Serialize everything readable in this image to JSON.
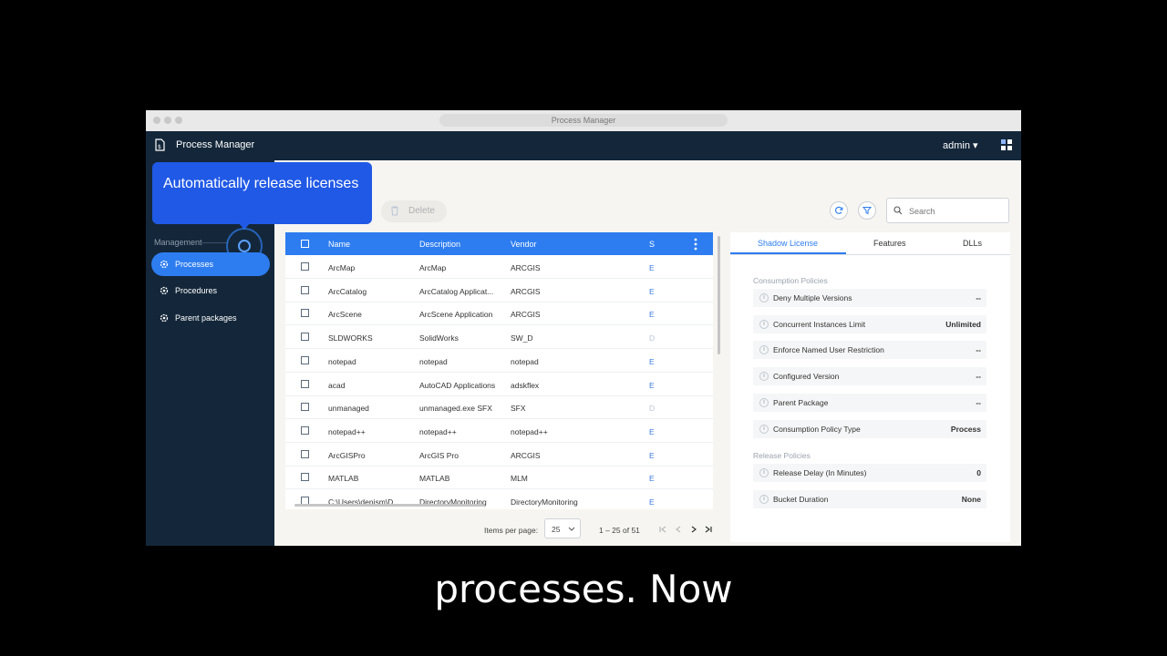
{
  "window": {
    "url_title": "Process Manager"
  },
  "appbar": {
    "title": "Process Manager",
    "user": "admin ▾"
  },
  "tooltip": {
    "text": "Automatically release licenses"
  },
  "sidebar": {
    "section": "Management",
    "items": [
      {
        "label": "Processes",
        "active": true
      },
      {
        "label": "Procedures",
        "active": false
      },
      {
        "label": "Parent packages",
        "active": false
      }
    ]
  },
  "toolbar": {
    "delete_label": "Delete",
    "search_placeholder": "Search"
  },
  "table": {
    "headers": [
      "Name",
      "Description",
      "Vendor",
      "S"
    ],
    "rows": [
      {
        "name": "ArcMap",
        "description": "ArcMap",
        "vendor": "ARCGIS",
        "s": "E"
      },
      {
        "name": "ArcCatalog",
        "description": "ArcCatalog Applicat...",
        "vendor": "ARCGIS",
        "s": "E"
      },
      {
        "name": "ArcScene",
        "description": "ArcScene Application",
        "vendor": "ARCGIS",
        "s": "E"
      },
      {
        "name": "SLDWORKS",
        "description": "SolidWorks",
        "vendor": "SW_D",
        "s": "D"
      },
      {
        "name": "notepad",
        "description": "notepad",
        "vendor": "notepad",
        "s": "E"
      },
      {
        "name": "acad",
        "description": "AutoCAD Applications",
        "vendor": "adskflex",
        "s": "E"
      },
      {
        "name": "unmanaged",
        "description": "unmanaged.exe SFX",
        "vendor": "SFX",
        "s": "D"
      },
      {
        "name": "notepad++",
        "description": "notepad++",
        "vendor": "notepad++",
        "s": "E"
      },
      {
        "name": "ArcGISPro",
        "description": "ArcGIS Pro",
        "vendor": "ARCGIS",
        "s": "E"
      },
      {
        "name": "MATLAB",
        "description": "MATLAB",
        "vendor": "MLM",
        "s": "E"
      },
      {
        "name": "C:\\Users\\denism\\D...",
        "description": "DirectoryMonitoring",
        "vendor": "DirectoryMonitoring",
        "s": "E"
      }
    ]
  },
  "pager": {
    "items_per_page_label": "Items per page:",
    "page_size": "25",
    "range": "1 – 25 of 51"
  },
  "panel": {
    "tabs": [
      "Shadow License",
      "Features",
      "DLLs"
    ],
    "consumption_title": "Consumption Policies",
    "consumption": [
      {
        "key": "Deny Multiple Versions",
        "value": "--"
      },
      {
        "key": "Concurrent Instances Limit",
        "value": "Unlimited"
      },
      {
        "key": "Enforce Named User Restriction",
        "value": "--"
      },
      {
        "key": "Configured Version",
        "value": "--"
      },
      {
        "key": "Parent Package",
        "value": "--"
      },
      {
        "key": "Consumption Policy Type",
        "value": "Process"
      }
    ],
    "release_title": "Release Policies",
    "release": [
      {
        "key": "Release Delay (In Minutes)",
        "value": "0"
      },
      {
        "key": "Bucket Duration",
        "value": "None"
      }
    ]
  },
  "caption": "processes. Now"
}
